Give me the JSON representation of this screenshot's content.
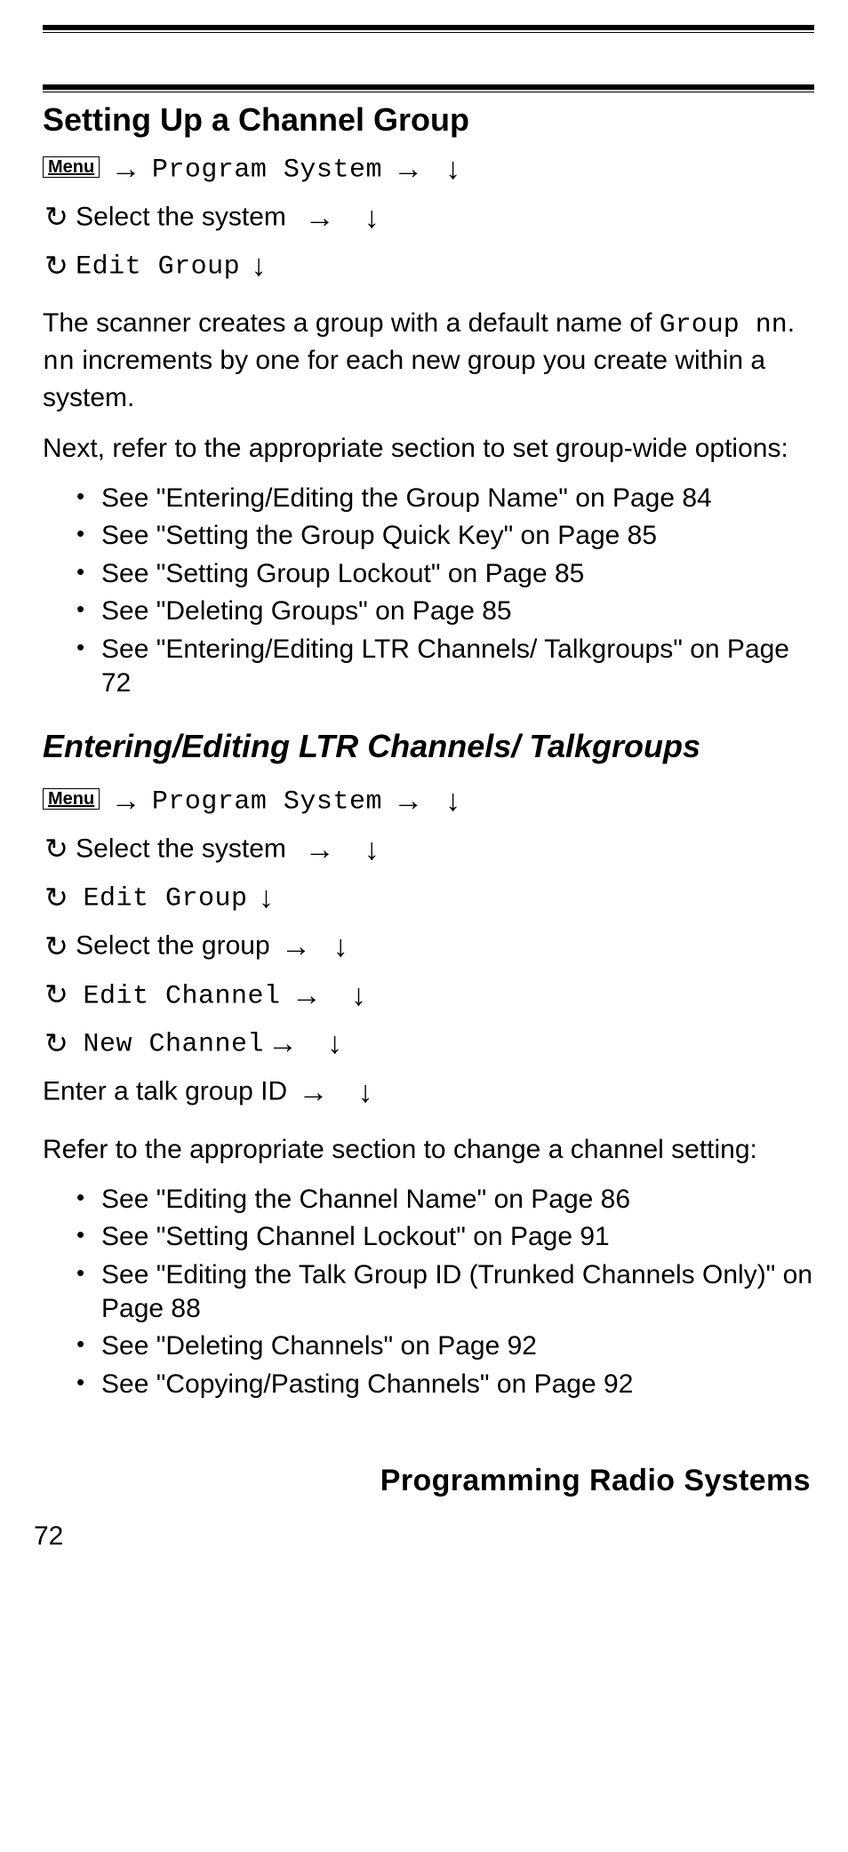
{
  "menu_label": "Menu",
  "arrows": {
    "right": "→",
    "down": "↓",
    "scroll": "↺"
  },
  "section1": {
    "heading": "Setting Up a Channel Group",
    "nav": {
      "line1_mono": "Program System",
      "line2_text": "Select the system",
      "line3_mono": "Edit Group"
    },
    "para1_a": "The scanner creates a group with a default name of ",
    "para1_mono1": "Group nn",
    "para1_b": ". ",
    "para1_mono2": "nn",
    "para1_c": " increments by one for each new group you create within a system.",
    "para2": "Next, refer to the appropriate section to set group-wide options:",
    "bullets": [
      "See \"Entering/Editing the Group Name\" on Page 84",
      "See \"Setting the Group Quick Key\" on Page 85",
      "See \"Setting Group Lockout\" on Page 85",
      "See \"Deleting Groups\" on Page 85",
      "See \"Entering/Editing LTR Channels/ Talkgroups\" on Page 72"
    ]
  },
  "section2": {
    "heading": "Entering/Editing LTR Channels/ Talkgroups",
    "nav": {
      "line1_mono": "Program System",
      "line2_text": "Select the system",
      "line3_mono": "Edit Group",
      "line4_text": "Select the group",
      "line5_mono": "Edit Channel",
      "line6_mono": "New Channel",
      "line7_text": "Enter a talk group ID"
    },
    "para1": "Refer to the appropriate section to change a channel setting:",
    "bullets": [
      "See \"Editing the Channel Name\" on Page 86",
      "See \"Setting Channel Lockout\" on Page 91",
      "See \"Editing the Talk Group ID (Trunked Channels Only)\" on Page 88",
      "See \"Deleting Channels\" on Page 92",
      "See \"Copying/Pasting Channels\" on Page 92"
    ]
  },
  "footer": {
    "title": "Programming Radio Systems",
    "page": "72"
  }
}
